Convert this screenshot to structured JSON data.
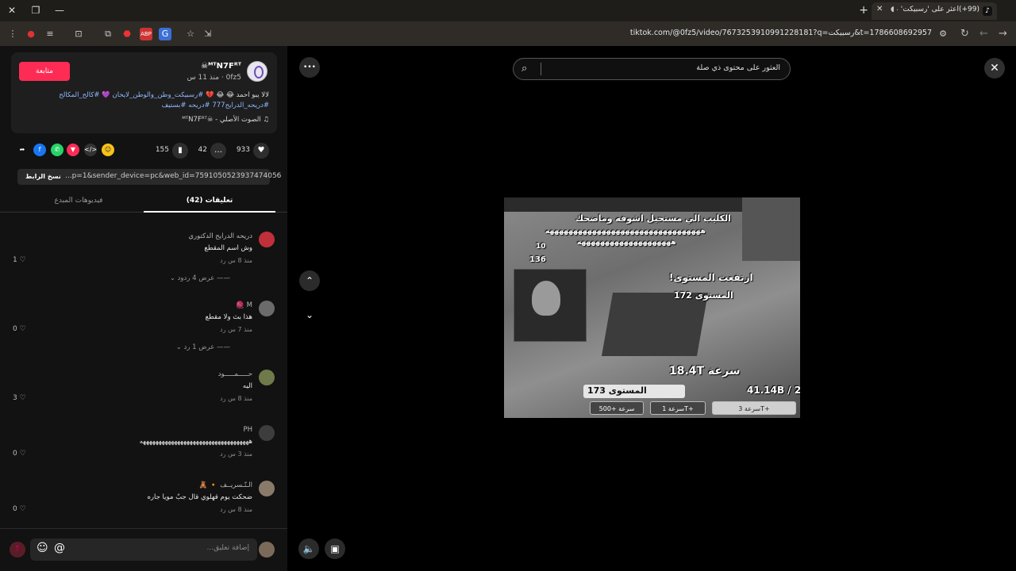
{
  "browser": {
    "tab_title": "(99+)اعثر على 'رسبيكت' على...",
    "url": "tiktok.com/@0fz5/video/7673253910991228181?q=رسبيكت&t=1786608692957",
    "window_controls": {
      "close": "✕",
      "restore": "❐",
      "minimize": "—"
    },
    "new_tab": "+",
    "tab_close": "✕",
    "tab_icon": "tiktok-icon"
  },
  "author": {
    "display_name": "☠ᴹᵀN7Fᴿᵀ",
    "meta": "0fz5 · منذ 11 س",
    "follow_label": "متابعة",
    "caption_text": "لالا يبو احمد 😂 😂 💔 ",
    "caption_tags": "#رسبيكت_وطن_والوطن_لايخان 💜 #كالح_المكالح #دريحه_الدرايح777 #دريحه #بستيف",
    "music": "الصوت الأصلي - ☠ᴹᵀN7Fᴿᵀ",
    "music_icon": "♫"
  },
  "stats": {
    "likes": "933",
    "comments": "42",
    "saves": "155",
    "like_icon": "heart-icon",
    "comment_icon": "comment-icon",
    "save_icon": "bookmark-icon"
  },
  "link": {
    "copy_label": "نسخ الرابط",
    "url_text": "...p=1&sender_device=pc&web_id=7591050523937474056"
  },
  "tabs": {
    "comments": "تعليقات (42)",
    "creator_videos": "فيديوهات المبدع"
  },
  "comments": [
    {
      "user": "دريحه الدرايح الدكتوري",
      "text": "وش اسم المقطع",
      "meta": "منذ 8 س   رد",
      "likes": "1",
      "replies": "عرض 4 ردود",
      "avatar_color": "#c0303a"
    },
    {
      "user": "M 🧶",
      "text": "هذا بث ولا مقطع",
      "meta": "منذ 7 س   رد",
      "likes": "0",
      "replies": "عرض 1 رد",
      "avatar_color": "#6b6b6b"
    },
    {
      "user": "حـــــمـــــود",
      "text": "اليه",
      "meta": "منذ 8 س   رد",
      "likes": "3",
      "replies": "",
      "avatar_color": "#6e7a4a"
    },
    {
      "user": "PH",
      "text": "هههههههههههههههههههههههههههههههههههه",
      "meta": "منذ 3 س   رد",
      "likes": "0",
      "replies": "",
      "avatar_color": "#3d3d3d"
    },
    {
      "user": "الـنّـسريــف 🔸 🧸",
      "text": "ضحكت يوم قهلوي قال جبٌ مويا جاره",
      "meta": "منذ 8 س   رد",
      "likes": "0",
      "replies": "",
      "avatar_color": "#8a7a6a"
    }
  ],
  "add_comment": {
    "placeholder": "إضافة تعليق...",
    "emoji_icon": "☺",
    "mention_icon": "@",
    "send_icon": "↑"
  },
  "controls": {
    "more": "•••",
    "up": "⌃",
    "down": "⌄",
    "volume": "🔈",
    "device": "▣"
  },
  "video": {
    "search_placeholder": "العثور على محتوى ذي صلة",
    "close": "✕",
    "overlay_caption_1": "الكليب الي مستحيل اشوفه وماضحك",
    "overlay_caption_2": "هههههههههههههههههههههههههههههههههه",
    "overlay_caption_3": "ههههههههههههههههههههه",
    "level_up": "ارتفعت المستوى!",
    "level_value": "المستوى 172",
    "speed": "سرعة 18.4T",
    "level_bar": "المستوى 173",
    "total": "41.14B / 2.",
    "score_a": "10",
    "score_b": "136",
    "btn_1": "سرعة 3T+",
    "btn_2": "سرعة 1T+",
    "btn_3": "500+ سرعة"
  }
}
